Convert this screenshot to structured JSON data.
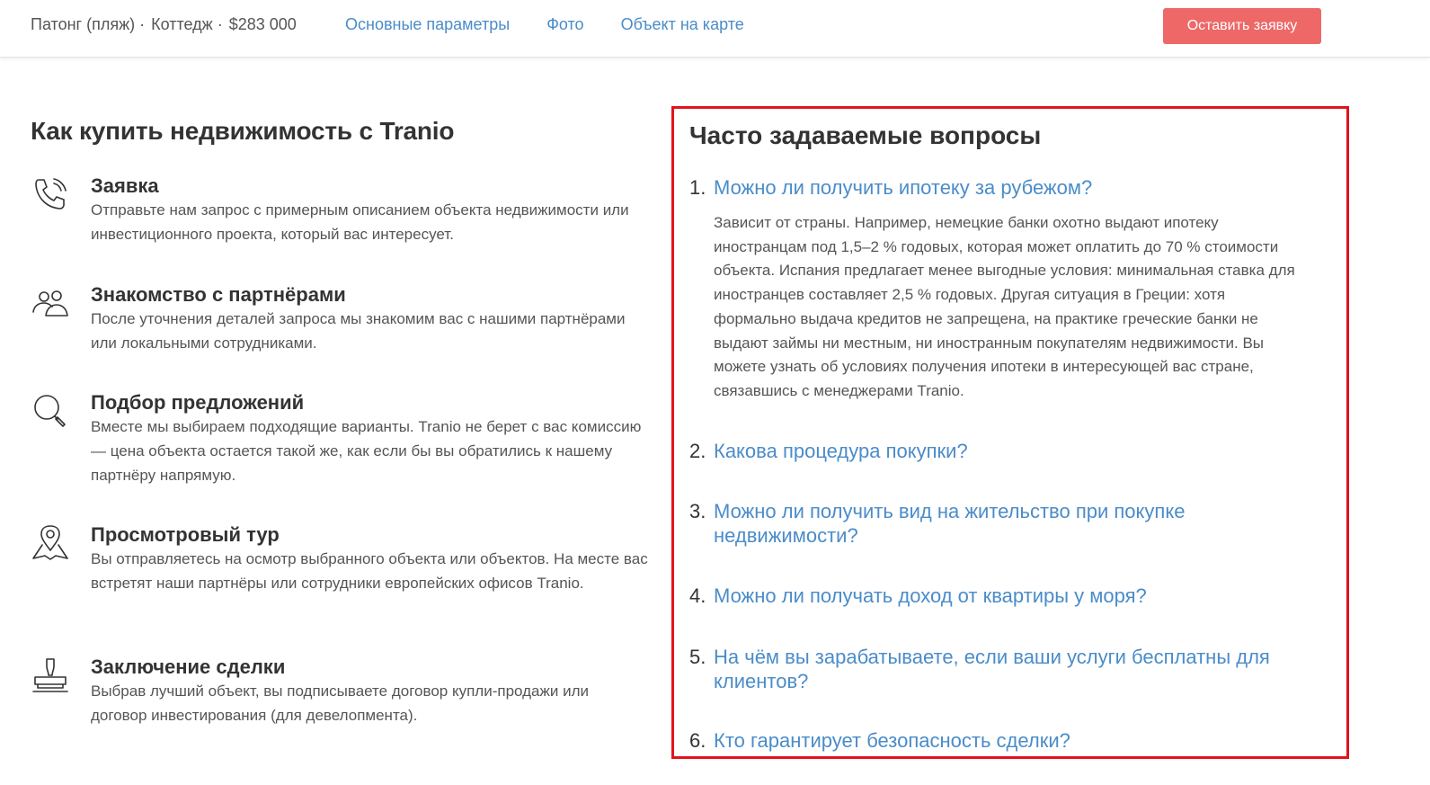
{
  "header": {
    "crumbs": [
      "Патонг (пляж) ·",
      "Коттедж ·",
      "$283 000"
    ],
    "nav": [
      "Основные параметры",
      "Фото",
      "Объект на карте"
    ],
    "cta_label": "Оставить заявку",
    "accent_color": "#ee6868",
    "link_color": "#4a8cc9"
  },
  "how_to_buy": {
    "title": "Как купить недвижимость с Tranio",
    "steps": [
      {
        "icon": "phone-icon",
        "title": "Заявка",
        "text": "Отправьте нам запрос с примерным описанием объекта недвижимости или инвестиционного проекта, который вас интересует."
      },
      {
        "icon": "people-icon",
        "title": "Знакомство с партнёрами",
        "text": "После уточнения деталей запроса мы знакомим вас с нашими партнёрами или локальными сотрудниками."
      },
      {
        "icon": "search-icon",
        "title": "Подбор предложений",
        "text": "Вместе мы выбираем подходящие варианты. Tranio не берет с вас комиссию — цена объекта остается такой же, как если бы вы обратились к нашему партнёру напрямую."
      },
      {
        "icon": "map-pin-icon",
        "title": "Просмотровый тур",
        "text": "Вы отправляетесь на осмотр выбранного объекта или объектов. На месте вас встретят наши партнёры или сотрудники европейских офисов Tranio."
      },
      {
        "icon": "stamp-icon",
        "title": "Заключение сделки",
        "text": "Выбрав лучший объект, вы подписываете договор купли-продажи или договор инвестирования (для девелопмента)."
      }
    ]
  },
  "faq": {
    "title": "Часто задаваемые вопросы",
    "highlight_color": "#e0141c",
    "items": [
      {
        "num": "1.",
        "question": "Можно ли получить ипотеку за рубежом?",
        "answer": "Зависит от страны. Например, немецкие банки охотно выдают ипотеку иностранцам под 1,5–2 % годовых, которая может оплатить до 70 % стоимости объекта. Испания предлагает менее выгодные условия: минимальная ставка для иностранцев составляет 2,5 % годовых. Другая ситуация в Греции: хотя формально выдача кредитов не запрещена, на практике греческие банки не выдают займы ни местным, ни иностранным покупателям недвижимости. Вы можете узнать об условиях получения ипотеки в интересующей вас стране, связавшись с менеджерами Tranio."
      },
      {
        "num": "2.",
        "question": "Какова процедура покупки?"
      },
      {
        "num": "3.",
        "question": "Можно ли получить вид на жительство при покупке недвижимости?"
      },
      {
        "num": "4.",
        "question": "Можно ли получать доход от квартиры у моря?"
      },
      {
        "num": "5.",
        "question": "На чём вы зарабатываете, если ваши услуги бесплатны для клиентов?"
      },
      {
        "num": "6.",
        "question": "Кто гарантирует безопасность сделки?"
      }
    ]
  }
}
